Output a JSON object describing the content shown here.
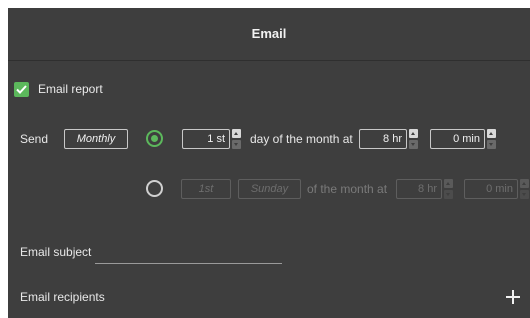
{
  "dialog": {
    "title": "Email"
  },
  "email_report": {
    "label": "Email report",
    "checked": true
  },
  "schedule": {
    "send_label": "Send",
    "frequency_button": "Monthly",
    "option_day": {
      "selected": true,
      "day_value": "1 st",
      "day_text": "day of the month at",
      "hour_value": "8 hr",
      "minute_value": "0 min"
    },
    "option_weekday": {
      "selected": false,
      "ordinal_value": "1st",
      "weekday_value": "Sunday",
      "of_text": "of the month at",
      "hour_value": "8 hr",
      "minute_value": "0 min"
    }
  },
  "email_subject": {
    "label": "Email subject",
    "value": ""
  },
  "email_recipients": {
    "label": "Email recipients",
    "add_icon": "plus-icon"
  },
  "colors": {
    "panel": "#3e3e3e",
    "accent": "#5cb85c"
  }
}
